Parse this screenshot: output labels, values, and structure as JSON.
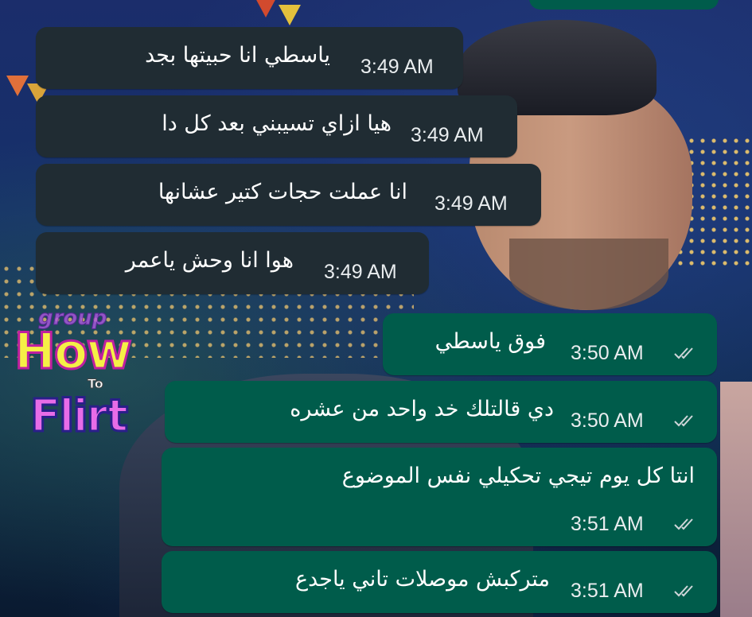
{
  "watermark": {
    "line1": "group",
    "line2": "How",
    "line3": "To",
    "line4": "Flirt"
  },
  "colors": {
    "incoming_bubble": "#202c33",
    "outgoing_bubble": "#005c4b",
    "tick_read": "#cfd6d9"
  },
  "messages": [
    {
      "direction": "incoming",
      "text": "ياسطي انا حبيتها بجد",
      "time": "3:49 AM"
    },
    {
      "direction": "incoming",
      "text": "هيا ازاي تسيبني بعد كل دا",
      "time": "3:49 AM"
    },
    {
      "direction": "incoming",
      "text": "انا عملت حجات كتير عشانها",
      "time": "3:49 AM"
    },
    {
      "direction": "incoming",
      "text": "هوا انا وحش ياعمر",
      "time": "3:49 AM"
    },
    {
      "direction": "outgoing",
      "text": "فوق ياسطي",
      "time": "3:50 AM",
      "status_icon": "double-check-icon"
    },
    {
      "direction": "outgoing",
      "text": "دي قالتلك خد واحد من عشره",
      "time": "3:50 AM",
      "status_icon": "double-check-icon"
    },
    {
      "direction": "outgoing",
      "text": "انتا كل يوم تيجي تحكيلي نفس الموضوع",
      "time": "3:51 AM",
      "status_icon": "double-check-icon"
    },
    {
      "direction": "outgoing",
      "text": "متركبش موصلات تاني ياجدع",
      "time": "3:51 AM",
      "status_icon": "double-check-icon"
    }
  ]
}
